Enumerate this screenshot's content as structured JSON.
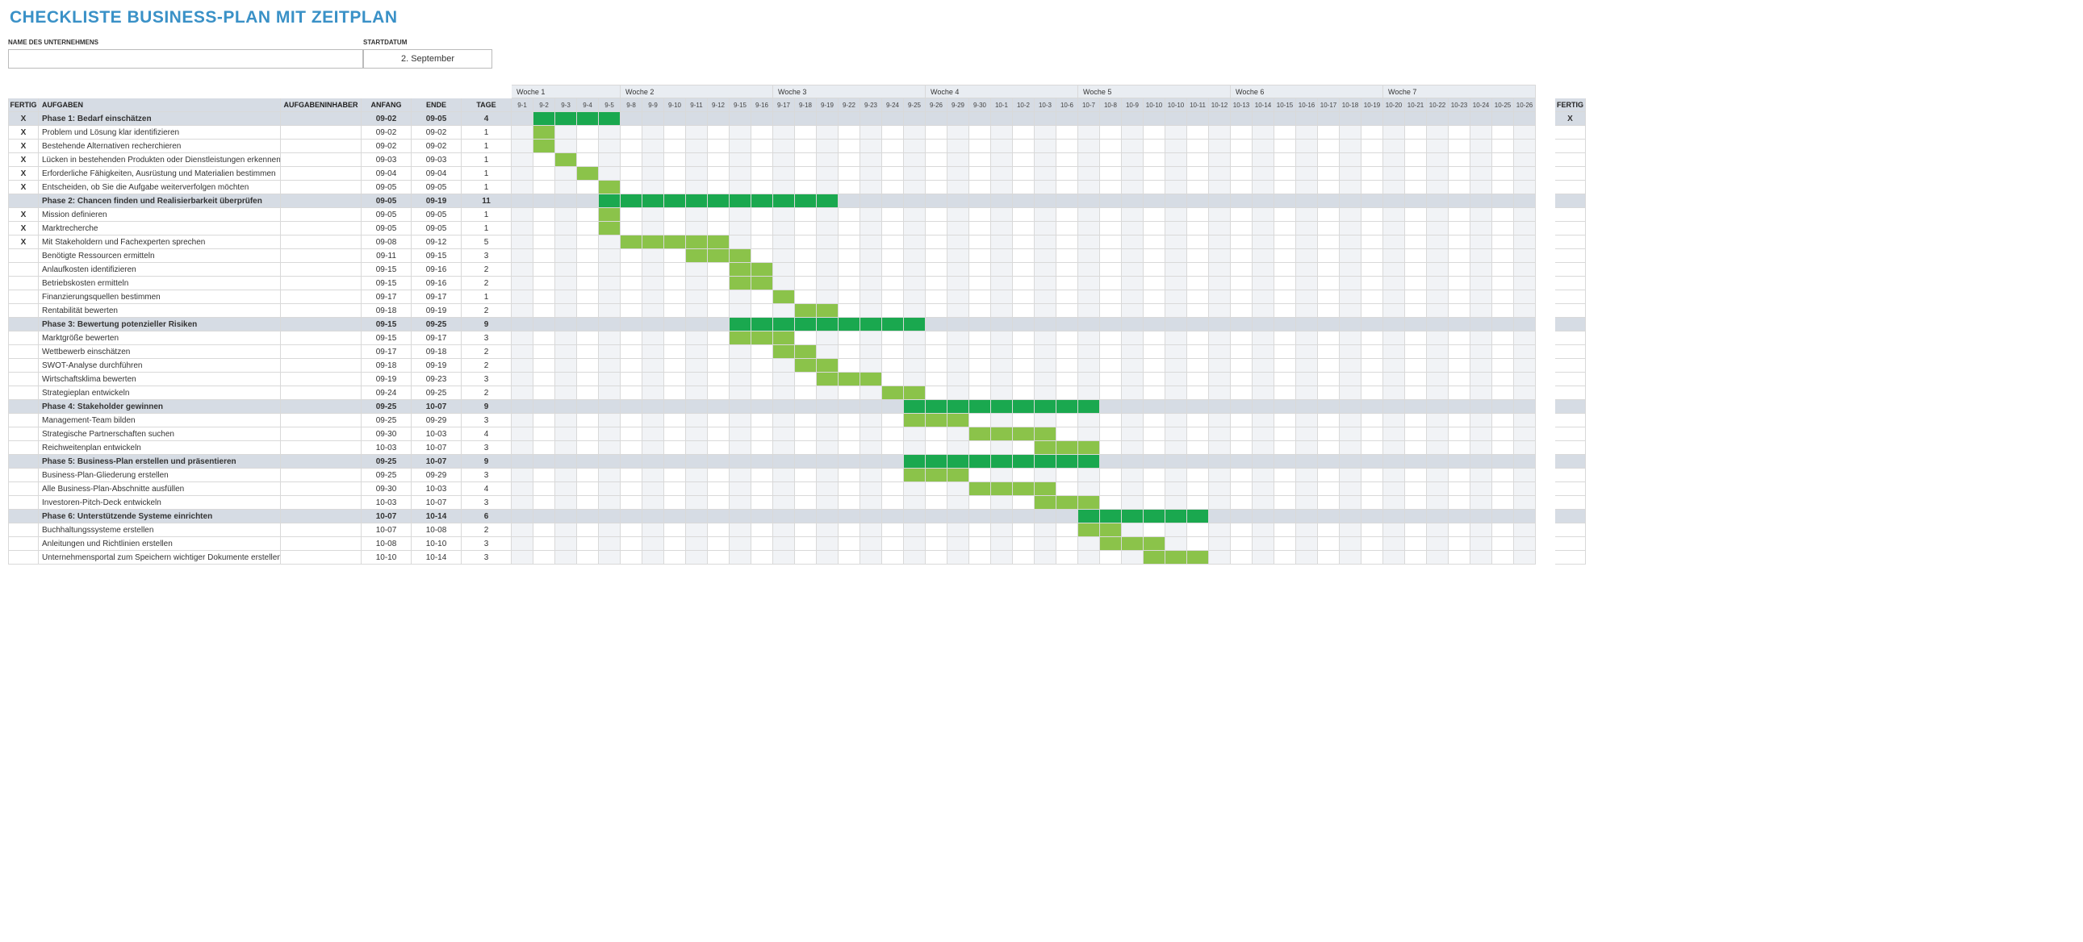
{
  "title": "CHECKLISTE BUSINESS-PLAN MIT ZEITPLAN",
  "meta": {
    "company_label": "NAME DES UNTERNEHMENS",
    "company_value": "",
    "startdate_label": "STARTDATUM",
    "startdate_value": "2. September"
  },
  "columns": {
    "fertig": "FERTIG",
    "aufgaben": "AUFGABEN",
    "owner": "AUFGABENINHABER",
    "anfang": "ANFANG",
    "ende": "ENDE",
    "tage": "TAGE",
    "fertig_right": "FERTIG"
  },
  "weeks": [
    {
      "label": "Woche 1",
      "span": 5
    },
    {
      "label": "Woche 2",
      "span": 7
    },
    {
      "label": "Woche 3",
      "span": 7
    },
    {
      "label": "Woche 4",
      "span": 7
    },
    {
      "label": "Woche 5",
      "span": 7
    },
    {
      "label": "Woche 6",
      "span": 7
    },
    {
      "label": "Woche 7",
      "span": 7
    }
  ],
  "ticks": [
    "9-1",
    "9-2",
    "9-3",
    "9-4",
    "9-5",
    "9-8",
    "9-9",
    "9-10",
    "9-11",
    "9-12",
    "9-15",
    "9-16",
    "9-17",
    "9-18",
    "9-19",
    "9-22",
    "9-23",
    "9-24",
    "9-25",
    "9-26",
    "9-29",
    "9-30",
    "10-1",
    "10-2",
    "10-3",
    "10-6",
    "10-7",
    "10-8",
    "10-9",
    "10-10",
    "10-10",
    "10-11",
    "10-12",
    "10-13",
    "10-14",
    "10-15",
    "10-16",
    "10-17",
    "10-18",
    "10-19",
    "10-20",
    "10-21",
    "10-22",
    "10-23",
    "10-24",
    "10-25",
    "10-26"
  ],
  "rows": [
    {
      "type": "phase",
      "done": "X",
      "name": "Phase 1: Bedarf einschätzen",
      "owner": "",
      "start": "09-02",
      "end": "09-05",
      "days": "4",
      "bar": [
        1,
        4
      ],
      "done_r": "X"
    },
    {
      "type": "task",
      "done": "X",
      "name": "Problem und Lösung klar identifizieren",
      "owner": "",
      "start": "09-02",
      "end": "09-02",
      "days": "1",
      "bar": [
        1,
        1
      ]
    },
    {
      "type": "task",
      "done": "X",
      "name": "Bestehende Alternativen recherchieren",
      "owner": "",
      "start": "09-02",
      "end": "09-02",
      "days": "1",
      "bar": [
        1,
        1
      ]
    },
    {
      "type": "task",
      "done": "X",
      "name": "Lücken in bestehenden Produkten oder Dienstleistungen erkennen",
      "owner": "",
      "start": "09-03",
      "end": "09-03",
      "days": "1",
      "bar": [
        2,
        1
      ]
    },
    {
      "type": "task",
      "done": "X",
      "name": "Erforderliche Fähigkeiten, Ausrüstung und Materialien bestimmen",
      "owner": "",
      "start": "09-04",
      "end": "09-04",
      "days": "1",
      "bar": [
        3,
        1
      ]
    },
    {
      "type": "task",
      "done": "X",
      "name": "Entscheiden, ob Sie die Aufgabe weiterverfolgen möchten",
      "owner": "",
      "start": "09-05",
      "end": "09-05",
      "days": "1",
      "bar": [
        4,
        1
      ]
    },
    {
      "type": "phase",
      "done": "",
      "name": "Phase 2: Chancen finden und Realisierbarkeit überprüfen",
      "owner": "",
      "start": "09-05",
      "end": "09-19",
      "days": "11",
      "bar": [
        4,
        11
      ],
      "done_r": ""
    },
    {
      "type": "task",
      "done": "X",
      "name": "Mission definieren",
      "owner": "",
      "start": "09-05",
      "end": "09-05",
      "days": "1",
      "bar": [
        4,
        1
      ]
    },
    {
      "type": "task",
      "done": "X",
      "name": "Marktrecherche",
      "owner": "",
      "start": "09-05",
      "end": "09-05",
      "days": "1",
      "bar": [
        4,
        1
      ]
    },
    {
      "type": "task",
      "done": "X",
      "name": "Mit Stakeholdern und Fachexperten sprechen",
      "owner": "",
      "start": "09-08",
      "end": "09-12",
      "days": "5",
      "bar": [
        5,
        5
      ]
    },
    {
      "type": "task",
      "done": "",
      "name": "Benötigte Ressourcen ermitteln",
      "owner": "",
      "start": "09-11",
      "end": "09-15",
      "days": "3",
      "bar": [
        8,
        3
      ]
    },
    {
      "type": "task",
      "done": "",
      "name": "Anlaufkosten identifizieren",
      "owner": "",
      "start": "09-15",
      "end": "09-16",
      "days": "2",
      "bar": [
        10,
        2
      ]
    },
    {
      "type": "task",
      "done": "",
      "name": "Betriebskosten ermitteln",
      "owner": "",
      "start": "09-15",
      "end": "09-16",
      "days": "2",
      "bar": [
        10,
        2
      ]
    },
    {
      "type": "task",
      "done": "",
      "name": "Finanzierungsquellen bestimmen",
      "owner": "",
      "start": "09-17",
      "end": "09-17",
      "days": "1",
      "bar": [
        12,
        1
      ]
    },
    {
      "type": "task",
      "done": "",
      "name": "Rentabilität bewerten",
      "owner": "",
      "start": "09-18",
      "end": "09-19",
      "days": "2",
      "bar": [
        13,
        2
      ]
    },
    {
      "type": "phase",
      "done": "",
      "name": "Phase 3: Bewertung potenzieller Risiken",
      "owner": "",
      "start": "09-15",
      "end": "09-25",
      "days": "9",
      "bar": [
        10,
        9
      ],
      "done_r": ""
    },
    {
      "type": "task",
      "done": "",
      "name": "Marktgröße bewerten",
      "owner": "",
      "start": "09-15",
      "end": "09-17",
      "days": "3",
      "bar": [
        10,
        3
      ]
    },
    {
      "type": "task",
      "done": "",
      "name": "Wettbewerb einschätzen",
      "owner": "",
      "start": "09-17",
      "end": "09-18",
      "days": "2",
      "bar": [
        12,
        2
      ]
    },
    {
      "type": "task",
      "done": "",
      "name": "SWOT-Analyse durchführen",
      "owner": "",
      "start": "09-18",
      "end": "09-19",
      "days": "2",
      "bar": [
        13,
        2
      ]
    },
    {
      "type": "task",
      "done": "",
      "name": "Wirtschaftsklima bewerten",
      "owner": "",
      "start": "09-19",
      "end": "09-23",
      "days": "3",
      "bar": [
        14,
        3
      ]
    },
    {
      "type": "task",
      "done": "",
      "name": "Strategieplan entwickeln",
      "owner": "",
      "start": "09-24",
      "end": "09-25",
      "days": "2",
      "bar": [
        17,
        2
      ]
    },
    {
      "type": "phase",
      "done": "",
      "name": "Phase 4: Stakeholder gewinnen",
      "owner": "",
      "start": "09-25",
      "end": "10-07",
      "days": "9",
      "bar": [
        18,
        9
      ],
      "done_r": ""
    },
    {
      "type": "task",
      "done": "",
      "name": "Management-Team bilden",
      "owner": "",
      "start": "09-25",
      "end": "09-29",
      "days": "3",
      "bar": [
        18,
        3
      ]
    },
    {
      "type": "task",
      "done": "",
      "name": "Strategische Partnerschaften suchen",
      "owner": "",
      "start": "09-30",
      "end": "10-03",
      "days": "4",
      "bar": [
        21,
        4
      ]
    },
    {
      "type": "task",
      "done": "",
      "name": "Reichweitenplan entwickeln",
      "owner": "",
      "start": "10-03",
      "end": "10-07",
      "days": "3",
      "bar": [
        24,
        3
      ]
    },
    {
      "type": "phase",
      "done": "",
      "name": "Phase 5: Business-Plan erstellen und präsentieren",
      "owner": "",
      "start": "09-25",
      "end": "10-07",
      "days": "9",
      "bar": [
        18,
        9
      ],
      "done_r": ""
    },
    {
      "type": "task",
      "done": "",
      "name": "Business-Plan-Gliederung erstellen",
      "owner": "",
      "start": "09-25",
      "end": "09-29",
      "days": "3",
      "bar": [
        18,
        3
      ]
    },
    {
      "type": "task",
      "done": "",
      "name": "Alle Business-Plan-Abschnitte ausfüllen",
      "owner": "",
      "start": "09-30",
      "end": "10-03",
      "days": "4",
      "bar": [
        21,
        4
      ]
    },
    {
      "type": "task",
      "done": "",
      "name": "Investoren-Pitch-Deck entwickeln",
      "owner": "",
      "start": "10-03",
      "end": "10-07",
      "days": "3",
      "bar": [
        24,
        3
      ]
    },
    {
      "type": "phase",
      "done": "",
      "name": "Phase 6: Unterstützende Systeme einrichten",
      "owner": "",
      "start": "10-07",
      "end": "10-14",
      "days": "6",
      "bar": [
        26,
        6
      ],
      "done_r": ""
    },
    {
      "type": "task",
      "done": "",
      "name": "Buchhaltungssysteme erstellen",
      "owner": "",
      "start": "10-07",
      "end": "10-08",
      "days": "2",
      "bar": [
        26,
        2
      ]
    },
    {
      "type": "task",
      "done": "",
      "name": "Anleitungen und Richtlinien erstellen",
      "owner": "",
      "start": "10-08",
      "end": "10-10",
      "days": "3",
      "bar": [
        27,
        3
      ]
    },
    {
      "type": "task",
      "done": "",
      "name": "Unternehmensportal zum Speichern wichtiger Dokumente erstellen",
      "owner": "",
      "start": "10-10",
      "end": "10-14",
      "days": "3",
      "bar": [
        29,
        3
      ]
    }
  ]
}
